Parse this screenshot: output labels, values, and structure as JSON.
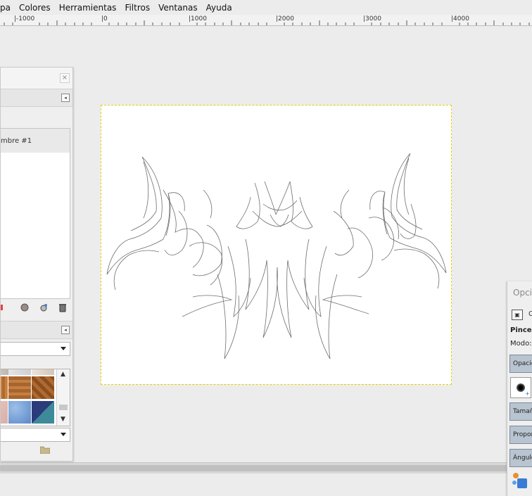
{
  "menubar": {
    "items": [
      "pa",
      "Colores",
      "Herramientas",
      "Filtros",
      "Ventanas",
      "Ayuda"
    ]
  },
  "ruler": {
    "labels": [
      "|-1000",
      "|0",
      "|1000",
      "|2000",
      "|3000",
      "|4000"
    ]
  },
  "left_dock": {
    "close_symbol": "×",
    "layer_name": "mbre #1",
    "tab_menu_symbol": "◂"
  },
  "right_dock": {
    "title": "Opcio",
    "tool_text": "C",
    "tool_name": "Pincel",
    "mode_label": "Modo:",
    "opacity_label": "Opacid",
    "size_label": "Tamañ",
    "aspect_label": "Propor",
    "angle_label": "Ángulo"
  },
  "colors": {
    "canvas_bg": "#ececec",
    "image_bg": "#ffffff",
    "selection_dash": "#e6d200",
    "option_box": "#b8c4d0"
  }
}
